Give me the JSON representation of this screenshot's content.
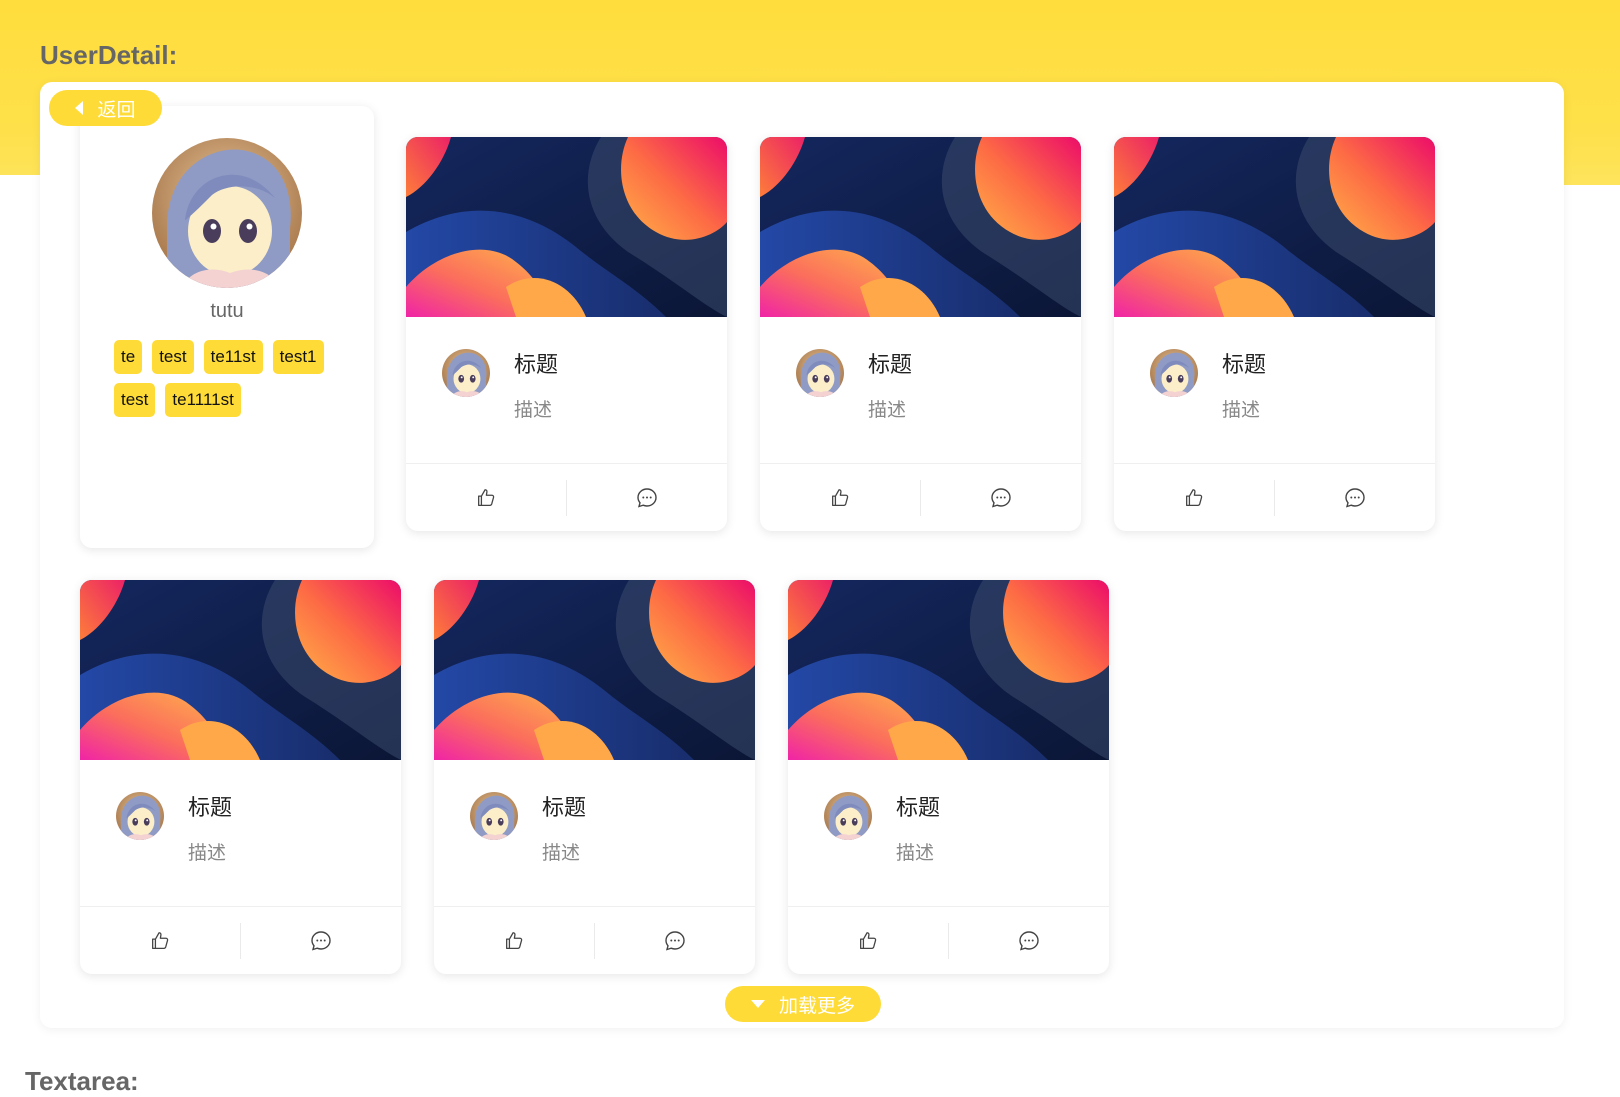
{
  "sections": {
    "user_detail_title": "UserDetail:",
    "textarea_title": "Textarea:"
  },
  "back_button": {
    "label": "返回",
    "icon": "caret-left-icon"
  },
  "profile": {
    "name": "tutu",
    "tags": [
      "te",
      "test",
      "te11st",
      "test1",
      "test",
      "te1111st"
    ]
  },
  "posts": [
    {
      "title": "标题",
      "desc": "描述"
    },
    {
      "title": "标题",
      "desc": "描述"
    },
    {
      "title": "标题",
      "desc": "描述"
    },
    {
      "title": "标题",
      "desc": "描述"
    },
    {
      "title": "标题",
      "desc": "描述"
    },
    {
      "title": "标题",
      "desc": "描述"
    }
  ],
  "post_actions": {
    "like_icon": "thumbs-up-icon",
    "comment_icon": "comment-icon"
  },
  "load_more": {
    "label": "加载更多",
    "icon": "caret-down-icon"
  },
  "colors": {
    "accent": "#fedb36",
    "title_gray": "#666666",
    "desc_gray": "#888888"
  }
}
